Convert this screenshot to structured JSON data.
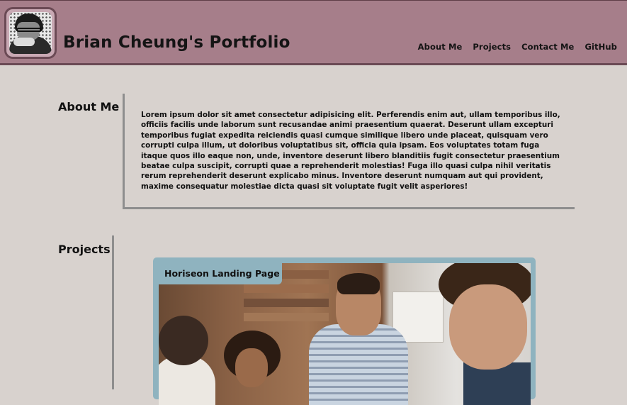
{
  "header": {
    "title": "Brian Cheung's Portfolio",
    "avatar_icon": "profile-photo",
    "nav": [
      {
        "label": "About Me"
      },
      {
        "label": "Projects"
      },
      {
        "label": "Contact Me"
      },
      {
        "label": "GitHub"
      }
    ]
  },
  "about": {
    "heading": "About Me",
    "text": "Lorem ipsum dolor sit amet consectetur adipisicing elit. Perferendis enim aut, ullam temporibus illo, officiis facilis unde laborum sunt recusandae animi praesentium quaerat. Deserunt ullam excepturi temporibus fugiat expedita reiciendis quasi cumque similique libero unde placeat, quisquam vero corrupti culpa illum, ut doloribus voluptatibus sit, officia quia ipsam. Eos voluptates totam fuga itaque quos illo eaque non, unde, inventore deserunt libero blanditiis fugit consectetur praesentium beatae culpa suscipit, corrupti quae a reprehenderit molestias! Fuga illo quasi culpa nihil veritatis rerum reprehenderit deserunt explicabo minus. Inventore deserunt numquam aut qui provident, maxime consequatur molestiae dicta quasi sit voluptate fugit velit asperiores!"
  },
  "projects": {
    "heading": "Projects",
    "items": [
      {
        "label": "Horiseon Landing Page"
      }
    ]
  },
  "colors": {
    "header_bg": "#a67e8a",
    "page_bg": "#d8d2ce",
    "card_accent": "#8fb3bf",
    "border_gray": "#8e8e8e"
  }
}
